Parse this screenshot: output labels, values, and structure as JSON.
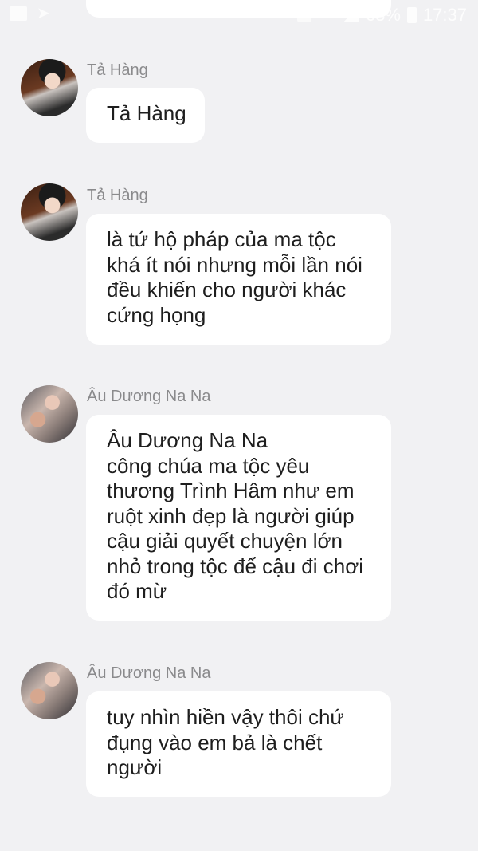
{
  "status_bar": {
    "battery_percent": "63%",
    "time": "17:37"
  },
  "messages": [
    {
      "sender": "Tả Hàng",
      "avatar": "avatar-ta-hang",
      "lines": [
        "Tả Hàng"
      ]
    },
    {
      "sender": "Tả Hàng",
      "avatar": "avatar-ta-hang",
      "lines": [
        "là tứ hộ pháp của ma tộc",
        "khá ít nói nhưng mỗi lần nói",
        "đều khiến cho người khác",
        "cứng họng"
      ]
    },
    {
      "sender": "Âu Dương Na Na",
      "avatar": "avatar-au-duong-na-na",
      "lines": [
        "Âu Dương Na Na",
        "công chúa ma tộc yêu",
        "thương Trình Hâm như em",
        "ruột xinh đẹp là người giúp",
        "cậu giải quyết chuyện lớn",
        "nhỏ trong tộc để cậu đi chơi",
        "đó mừ"
      ]
    },
    {
      "sender": "Âu Dương Na Na",
      "avatar": "avatar-au-duong-na-na",
      "lines": [
        "tuy nhìn hiền vậy thôi chứ",
        "đụng vào em bả là chết",
        "người"
      ]
    }
  ]
}
